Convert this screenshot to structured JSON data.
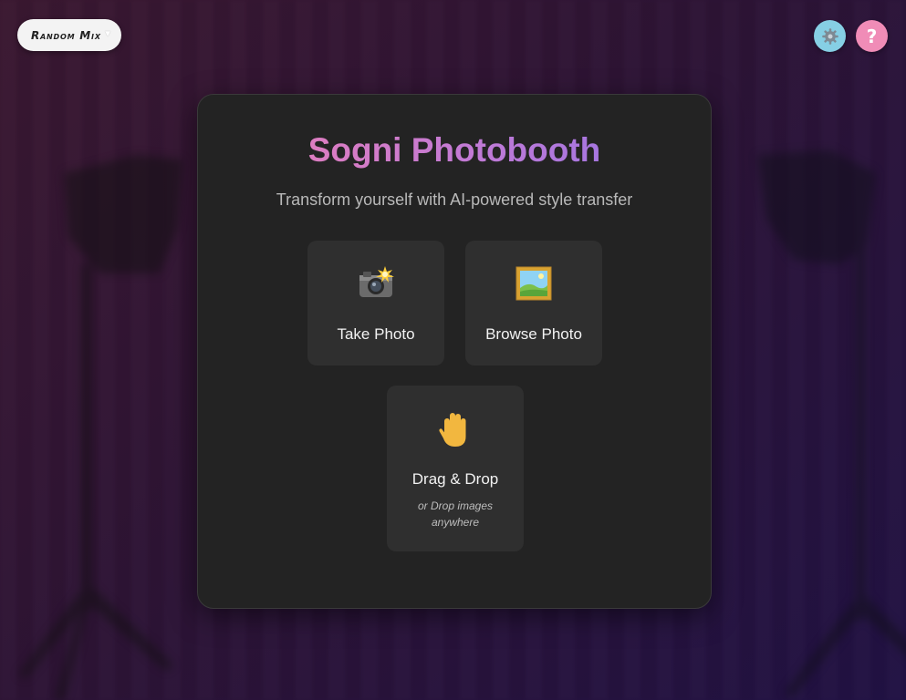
{
  "style_selector": {
    "value": "Random Mix",
    "chevron_icon": "chevron-down-icon"
  },
  "toolbar": {
    "settings_icon": "gear-icon",
    "help_label": "?",
    "settings_color": "#86cfe4",
    "help_color": "#f08cb7"
  },
  "card": {
    "title": "Sogni Photobooth",
    "subtitle": "Transform yourself with AI-powered style transfer",
    "options": {
      "take_photo": {
        "label": "Take Photo",
        "icon": "camera-flash-icon"
      },
      "browse_photo": {
        "label": "Browse Photo",
        "icon": "framed-picture-icon"
      },
      "drag_drop": {
        "label": "Drag & Drop",
        "hint": "or Drop images anywhere",
        "icon": "raised-hand-icon"
      }
    }
  },
  "colors": {
    "title_gradient_start": "#ef7fb4",
    "title_gradient_end": "#8f72e8",
    "card_background": "#232323",
    "tile_background": "#2f2f2f"
  }
}
